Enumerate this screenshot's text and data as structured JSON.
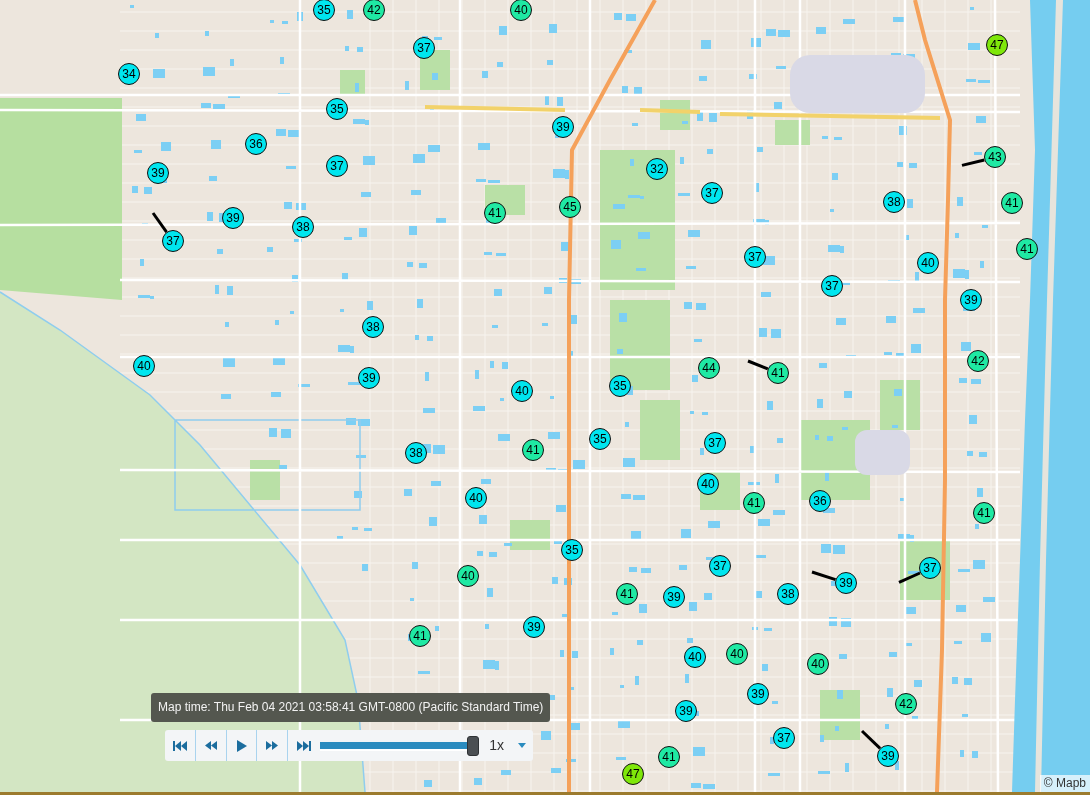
{
  "map": {
    "markers": [
      {
        "value": "35",
        "color": "#00e6ef",
        "tail": false
      },
      {
        "value": "42",
        "color": "#1fe9a3",
        "tail": false
      },
      {
        "value": "40",
        "color": "#1fe9a3",
        "tail": false
      },
      {
        "value": "37",
        "color": "#00e6ef",
        "tail": false
      },
      {
        "value": "47",
        "color": "#7fe70a",
        "tail": false
      },
      {
        "value": "34",
        "color": "#00e6ef",
        "tail": false
      },
      {
        "value": "35",
        "color": "#00e6ef",
        "tail": false
      },
      {
        "value": "39",
        "color": "#00e6ef",
        "tail": false
      },
      {
        "value": "36",
        "color": "#00e6ef",
        "tail": false
      },
      {
        "value": "43",
        "color": "#1fe9a3",
        "tail": true
      },
      {
        "value": "39",
        "color": "#00e6ef",
        "tail": false
      },
      {
        "value": "37",
        "color": "#00e6ef",
        "tail": false
      },
      {
        "value": "32",
        "color": "#00e6ef",
        "tail": false
      },
      {
        "value": "37",
        "color": "#00e6ef",
        "tail": false
      },
      {
        "value": "45",
        "color": "#1fe9a3",
        "tail": false
      },
      {
        "value": "38",
        "color": "#00e6ef",
        "tail": false
      },
      {
        "value": "41",
        "color": "#1fe9a3",
        "tail": false
      },
      {
        "value": "39",
        "color": "#00e6ef",
        "tail": false
      },
      {
        "value": "41",
        "color": "#1fe9a3",
        "tail": false
      },
      {
        "value": "38",
        "color": "#00e6ef",
        "tail": false
      },
      {
        "value": "37",
        "color": "#00e6ef",
        "tail": true
      },
      {
        "value": "41",
        "color": "#1fe9a3",
        "tail": false
      },
      {
        "value": "37",
        "color": "#00e6ef",
        "tail": false
      },
      {
        "value": "40",
        "color": "#00e6ef",
        "tail": false
      },
      {
        "value": "37",
        "color": "#00e6ef",
        "tail": false
      },
      {
        "value": "39",
        "color": "#00e6ef",
        "tail": false
      },
      {
        "value": "38",
        "color": "#00e6ef",
        "tail": false
      },
      {
        "value": "40",
        "color": "#00e6ef",
        "tail": false
      },
      {
        "value": "39",
        "color": "#00e6ef",
        "tail": false
      },
      {
        "value": "44",
        "color": "#1fe9a3",
        "tail": false
      },
      {
        "value": "41",
        "color": "#1fe9a3",
        "tail": true
      },
      {
        "value": "42",
        "color": "#1fe9a3",
        "tail": false
      },
      {
        "value": "40",
        "color": "#00e6ef",
        "tail": false
      },
      {
        "value": "35",
        "color": "#00e6ef",
        "tail": false
      },
      {
        "value": "35",
        "color": "#00e6ef",
        "tail": false
      },
      {
        "value": "37",
        "color": "#00e6ef",
        "tail": false
      },
      {
        "value": "38",
        "color": "#00e6ef",
        "tail": false
      },
      {
        "value": "41",
        "color": "#1fe9a3",
        "tail": false
      },
      {
        "value": "40",
        "color": "#00e6ef",
        "tail": false
      },
      {
        "value": "40",
        "color": "#00e6ef",
        "tail": false
      },
      {
        "value": "41",
        "color": "#1fe9a3",
        "tail": false
      },
      {
        "value": "36",
        "color": "#00e6ef",
        "tail": false
      },
      {
        "value": "41",
        "color": "#1fe9a3",
        "tail": false
      },
      {
        "value": "35",
        "color": "#00e6ef",
        "tail": false
      },
      {
        "value": "37",
        "color": "#00e6ef",
        "tail": false
      },
      {
        "value": "37",
        "color": "#00e6ef",
        "tail": true
      },
      {
        "value": "40",
        "color": "#1fe9a3",
        "tail": false
      },
      {
        "value": "39",
        "color": "#00e6ef",
        "tail": true
      },
      {
        "value": "41",
        "color": "#1fe9a3",
        "tail": false
      },
      {
        "value": "39",
        "color": "#00e6ef",
        "tail": false
      },
      {
        "value": "38",
        "color": "#00e6ef",
        "tail": false
      },
      {
        "value": "39",
        "color": "#00e6ef",
        "tail": false
      },
      {
        "value": "41",
        "color": "#1fe9a3",
        "tail": false
      },
      {
        "value": "40",
        "color": "#00e6ef",
        "tail": false
      },
      {
        "value": "40",
        "color": "#1fe9a3",
        "tail": false
      },
      {
        "value": "40",
        "color": "#1fe9a3",
        "tail": false
      },
      {
        "value": "39",
        "color": "#00e6ef",
        "tail": false
      },
      {
        "value": "42",
        "color": "#1fe9a3",
        "tail": false
      },
      {
        "value": "39",
        "color": "#00e6ef",
        "tail": false
      },
      {
        "value": "37",
        "color": "#00e6ef",
        "tail": false
      },
      {
        "value": "41",
        "color": "#1fe9a3",
        "tail": false
      },
      {
        "value": "39",
        "color": "#00e6ef",
        "tail": true
      },
      {
        "value": "47",
        "color": "#7fe70a",
        "tail": false
      }
    ],
    "attribution": "© Mapb"
  },
  "time_control": {
    "tooltip": "Map time: Thu Feb 04 2021 03:58:41 GMT-0800 (Pacific Standard Time)",
    "slider": {
      "level": 1
    },
    "speed": "1x"
  }
}
